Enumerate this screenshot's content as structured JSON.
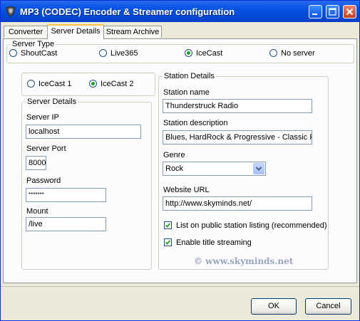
{
  "window": {
    "title": "MP3 (CODEC) Encoder & Streamer configuration"
  },
  "tabs": [
    {
      "label": "Converter",
      "active": false
    },
    {
      "label": "Server Details",
      "active": true
    },
    {
      "label": "Stream Archive",
      "active": false
    }
  ],
  "server_type": {
    "label": "Server Type",
    "options": [
      {
        "label": "ShoutCast",
        "selected": false
      },
      {
        "label": "Live365",
        "selected": false
      },
      {
        "label": "IceCast",
        "selected": true
      },
      {
        "label": "No server",
        "selected": false
      }
    ]
  },
  "icecast_version": {
    "options": [
      {
        "label": "IceCast 1",
        "selected": false
      },
      {
        "label": "IceCast 2",
        "selected": true
      }
    ]
  },
  "server_details": {
    "label": "Server Details",
    "ip_label": "Server IP",
    "ip_value": "localhost",
    "port_label": "Server Port",
    "port_value": "8000",
    "password_label": "Password",
    "password_value": "*******",
    "mount_label": "Mount",
    "mount_value": "/live"
  },
  "station_details": {
    "label": "Station Details",
    "name_label": "Station name",
    "name_value": "Thunderstruck Radio",
    "description_label": "Station description",
    "description_value": "Blues, HardRock & Progressive - Classic R",
    "genre_label": "Genre",
    "genre_value": "Rock",
    "url_label": "Website URL",
    "url_value": "http://www.skyminds.net/",
    "public_listing_label": "List on public station listing (recommended)",
    "public_listing_checked": true,
    "title_streaming_label": "Enable title streaming",
    "title_streaming_checked": true
  },
  "watermark": "© www.skyminds.net",
  "buttons": {
    "ok": "OK",
    "cancel": "Cancel"
  },
  "colors": {
    "titlebar": "#0a56e6",
    "dialog": "#ece9d8",
    "tab_highlight": "#ffc73c",
    "radio_selected": "#21a121"
  }
}
